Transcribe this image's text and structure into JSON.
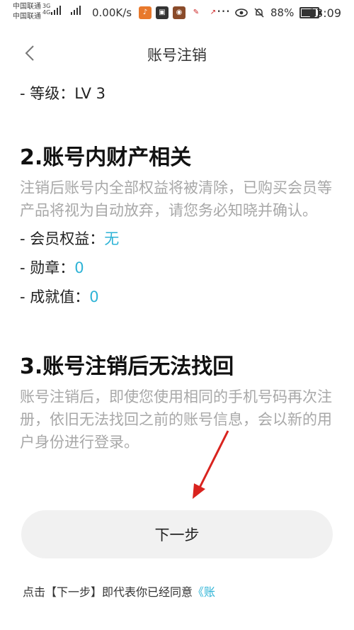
{
  "status_bar": {
    "carrier1": "中国联通",
    "carrier2": "中国联通",
    "net1": "3G",
    "net2": "4G",
    "speed": "0.00K/s",
    "more": "···",
    "battery": "88%",
    "time": "13:09"
  },
  "nav": {
    "title": "账号注销"
  },
  "content": {
    "level_line": "- 等级：LV 3",
    "section2": {
      "title": "2.账号内财产相关",
      "description": "注销后账号内全部权益将被清除，已购买会员等产品将视为自动放弃，请您务必知晓并确认。",
      "items": [
        {
          "label": "- 会员权益：",
          "value": "无"
        },
        {
          "label": "- 勋章：",
          "value": "0"
        },
        {
          "label": "- 成就值：",
          "value": "0"
        }
      ]
    },
    "section3": {
      "title": "3.账号注销后无法找回",
      "description": "账号注销后，即使您使用相同的手机号码再次注册，依旧无法找回之前的账号信息，会以新的用户身份进行登录。"
    }
  },
  "next_button": {
    "label": "下一步"
  },
  "agreement": {
    "text": "点击【下一步】即代表你已经同意",
    "link": "《账"
  },
  "colors": {
    "accent": "#2eb3d6",
    "muted_text": "#a8a8a8",
    "button_bg": "#f1f1f1",
    "annotation_arrow": "#d9231e"
  }
}
